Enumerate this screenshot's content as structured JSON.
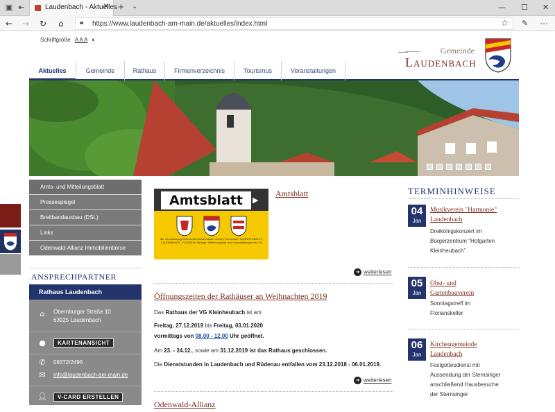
{
  "browser": {
    "tab_title": "Laudenbach - Aktuelles",
    "url": "https://www.laudenbach-am-main.de/aktuelles/index.html"
  },
  "header": {
    "fontsize_label": "Schriftgröße",
    "fontsize_options": "A A A",
    "logo_top": "Gemeinde",
    "logo_bottom": "Laudenbach"
  },
  "nav": {
    "items": [
      {
        "label": "Aktuelles",
        "active": true
      },
      {
        "label": "Gemeinde"
      },
      {
        "label": "Rathaus"
      },
      {
        "label": "Firmenverzeichnis"
      },
      {
        "label": "Tourismus"
      },
      {
        "label": "Veranstaltungen"
      }
    ]
  },
  "sidebar": {
    "menu": [
      {
        "label": "Amts- und Mitteilungsblatt"
      },
      {
        "label": "Pressespiegel"
      },
      {
        "label": "Breitbandausbau (DSL)"
      },
      {
        "label": "Links"
      },
      {
        "label": "Odenwald-Allianz Immobilienbörse"
      }
    ],
    "contact_heading": "Ansprechpartner",
    "contact_title": "Rathaus Laudenbach",
    "street": "Obernburger Straße 10",
    "city": "63925 Laudenbach",
    "map_button": "KARTENANSICHT",
    "phone": "09372/2496",
    "email": "info@laudenbach-am-main.de",
    "vcard_button": "V-CARD ERSTELLEN"
  },
  "main": {
    "amtsblatt_image_word": "Amtsblatt",
    "amtsblatt_image_small": "der Verwaltungsgemeinschaft Kleinheubach mit den Gemeinden KLEINHEUBACH - LAUDENBACH - RÜDENAU Beilage: Mitteilungsblatt und Veranstaltungen der VG",
    "article1_title": "Amtsblatt",
    "more_label": "weiterlesen",
    "article2_title": "Öffnungszeiten der Rathäuser an Weihnachten 2019",
    "p1_a": "Das ",
    "p1_b": "Rathaus der VG Kleinheubach",
    "p1_c": " ist am",
    "p2_a": "Freitag, 27.12.2019",
    "p2_b": " bis ",
    "p2_c": "Freitag, 03.01.2020",
    "p3_a": "vormittags von ",
    "p3_b": "08.00 - 12.00",
    "p3_c": " Uhr geöffnet.",
    "p4_a": "Am ",
    "p4_b": "23. - 24.12.",
    "p4_c": ", sowie am ",
    "p4_d": "31.12.2019",
    "p4_e": " ist das Rathaus geschlossen.",
    "p5_a": "Die ",
    "p5_b": "Dienststunden in Laudenbach und Rüdenau entfallen vom 23.12.2018 - 06.01.2019.",
    "article3_title": "Odenwald-Allianz"
  },
  "terminhinweise": {
    "heading": "Terminhinweise",
    "events": [
      {
        "day": "04",
        "month": "Jan",
        "title1": "Musikverein \"Harmonie\"",
        "title2": "Laudenbach",
        "desc": [
          "Dreikönigskonzert im",
          "Bürgerzentrum \"Hofgarten",
          "Kleinheubach\""
        ]
      },
      {
        "day": "05",
        "month": "Jan",
        "title1": "Obst- und",
        "title2": "Gartenbauverein",
        "desc": [
          "Sonntagstreff im",
          "Florianskeller"
        ]
      },
      {
        "day": "06",
        "month": "Jan",
        "title1": "Kirchengemeinde",
        "title2": "Laudenbach",
        "desc": [
          "Festgottesdienst mit",
          "Aussendung der Sternsinger",
          "anschließend Hausbesuche",
          "der Sternsinger"
        ]
      }
    ]
  },
  "colors": {
    "brand_blue": "#23336b",
    "brand_red": "#7b2a1e",
    "sidebar_gray": "#7a7a7a"
  }
}
